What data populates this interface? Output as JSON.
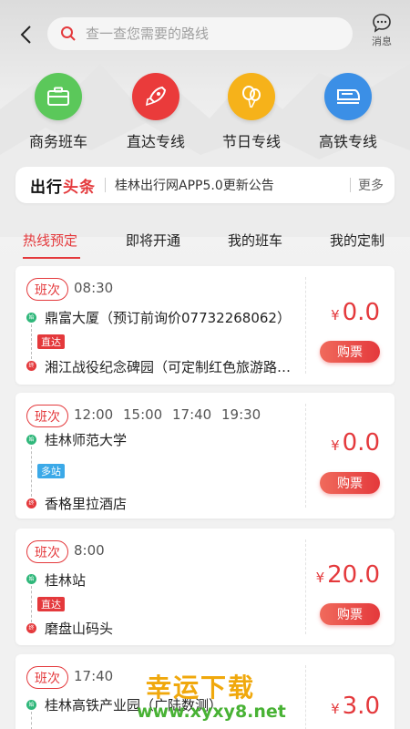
{
  "search": {
    "placeholder": "查一查您需要的路线"
  },
  "header": {
    "message_label": "消息"
  },
  "categories": [
    {
      "label": "商务班车",
      "icon": "briefcase-icon",
      "color": "#5bc85a"
    },
    {
      "label": "直达专线",
      "icon": "rocket-icon",
      "color": "#ea3b3b"
    },
    {
      "label": "节日专线",
      "icon": "balloon-icon",
      "color": "#f6b21a"
    },
    {
      "label": "高铁专线",
      "icon": "train-icon",
      "color": "#3b8fe6"
    }
  ],
  "news": {
    "logo_part1": "出行",
    "logo_part2": "头条",
    "text": "桂林出行网APP5.0更新公告",
    "more": "更多"
  },
  "tabs": [
    {
      "label": "热线预定",
      "active": true
    },
    {
      "label": "即将开通",
      "active": false
    },
    {
      "label": "我的班车",
      "active": false
    },
    {
      "label": "我的定制",
      "active": false
    }
  ],
  "routes": [
    {
      "badge": "班次",
      "times": "08:30",
      "start_dot": "始",
      "start": "鼎富大厦（预订前询价07732268062）",
      "tag": "直达",
      "end_dot": "终",
      "end": "湘江战役纪念碑园（可定制红色旅游路线）",
      "currency": "¥",
      "price": "0.0",
      "buy": "购票"
    },
    {
      "badge": "班次",
      "times": "12:00 15:00 17:40 19:30",
      "start_dot": "始",
      "start": "桂林师范大学",
      "tag": "多站",
      "end_dot": "终",
      "end": "香格里拉酒店",
      "currency": "¥",
      "price": "0.0",
      "buy": "购票"
    },
    {
      "badge": "班次",
      "times": "8:00",
      "start_dot": "始",
      "start": "桂林站",
      "tag": "直达",
      "end_dot": "终",
      "end": "磨盘山码头",
      "currency": "¥",
      "price": "20.0",
      "buy": "购票"
    },
    {
      "badge": "班次",
      "times": "17:40",
      "start_dot": "始",
      "start": "桂林高铁产业园（广陆数测）",
      "currency": "¥",
      "price": "3.0"
    }
  ],
  "watermark": {
    "line1": "幸运下载",
    "line2": "www.xyxy8.net"
  },
  "colors": {
    "accent": "#e4393c",
    "start_green": "#2fb77a",
    "tag_blue": "#3ba9e8"
  }
}
